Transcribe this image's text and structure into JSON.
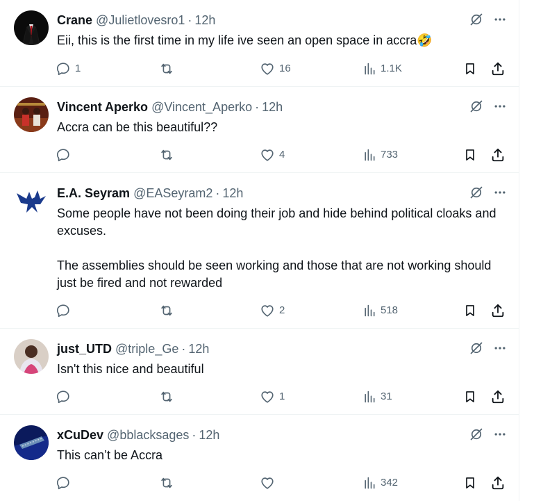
{
  "tweets": [
    {
      "name": "Crane",
      "handle": "@Julietlovesro1",
      "separator": "·",
      "time": "12h",
      "text": "Eii, this is the first time in my life ive seen an open space in accra🤣",
      "replies": "1",
      "retweets": "",
      "likes": "16",
      "views": "1.1K"
    },
    {
      "name": "Vincent Aperko",
      "handle": "@Vincent_Aperko",
      "separator": "·",
      "time": "12h",
      "text": "Accra can be this beautiful??",
      "replies": "",
      "retweets": "",
      "likes": "4",
      "views": "733"
    },
    {
      "name": "E.A. Seyram",
      "handle": "@EASeyram2",
      "separator": "·",
      "time": "12h",
      "text": "Some people have not been doing their job and hide behind political cloaks and excuses.\n\nThe assemblies should be seen working and those that are not working should just be fired and not rewarded",
      "replies": "",
      "retweets": "",
      "likes": "2",
      "views": "518"
    },
    {
      "name": "just_UTD",
      "handle": "@triple_Ge",
      "separator": "·",
      "time": "12h",
      "text": "Isn't this nice and beautiful",
      "replies": "",
      "retweets": "",
      "likes": "1",
      "views": "31"
    },
    {
      "name": "xCuDev",
      "handle": "@bblacksages",
      "separator": "·",
      "time": "12h",
      "text": "This can’t be Accra",
      "replies": "",
      "retweets": "",
      "likes": "",
      "views": "342"
    }
  ],
  "icons": {
    "grok": "grok-icon",
    "more": "more-icon",
    "reply": "reply-icon",
    "retweet": "retweet-icon",
    "like": "like-icon",
    "views": "views-icon",
    "bookmark": "bookmark-icon",
    "share": "share-icon"
  },
  "colors": {
    "text": "#0f1419",
    "secondary": "#536471",
    "divider": "#eff3f4"
  }
}
